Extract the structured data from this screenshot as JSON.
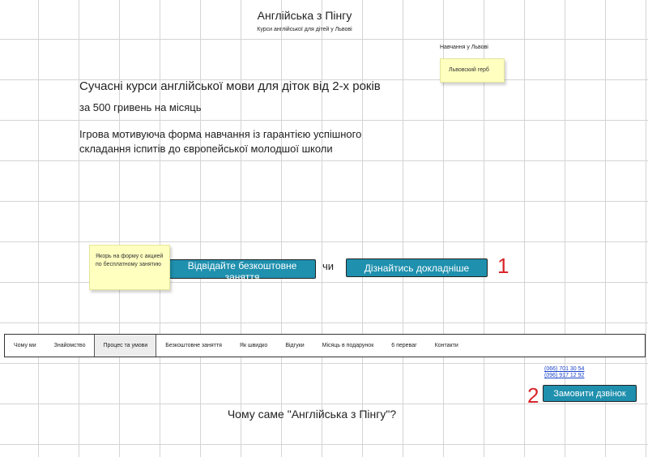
{
  "header": {
    "title": "Англійська з Пінгу",
    "subtitle": "Курси англійської для дітей у Львові"
  },
  "aside": {
    "lviv_label": "Навчання у Львові",
    "coat_note": "Львовский герб"
  },
  "hero": {
    "heading": "Сучасні курси англійської мови для діток від 2-х років",
    "price": "за 500 гривень на місяць",
    "description": "Ігрова мотивуюча форма навчання із гарантією успішного складання іспитів до європейської молодшої школи"
  },
  "cta": {
    "anchor_note": "Якорь на форму с акцией по бесплатному занятию",
    "free_lesson_label": "Відвідайте безкоштовне заняття",
    "or_text": "чи",
    "learn_more_label": "Дізнайтись докладніше",
    "marker_1": "1"
  },
  "nav": {
    "items": [
      {
        "label": "Чому ми"
      },
      {
        "label": "Знайомство"
      },
      {
        "label": "Процес та умови"
      },
      {
        "label": "Безкоштовне заняття"
      },
      {
        "label": "Як швидко"
      },
      {
        "label": "Відгуки"
      },
      {
        "label": "Місяць в подарунок"
      },
      {
        "label": "6 переваг"
      },
      {
        "label": "Контакти"
      }
    ],
    "active_index": 2
  },
  "contact": {
    "phone_1": "(066) 701 30 54",
    "phone_2": "(096) 917 12 92",
    "callback_label": "Замовити дзвінок",
    "marker_2": "2"
  },
  "section": {
    "title": "Чому саме \"Англійська з Пінгу\"?"
  },
  "colors": {
    "button": "#1f90ae",
    "sticky_note": "#ffffc0",
    "marker": "#d8262b",
    "link": "#1a43c9"
  }
}
